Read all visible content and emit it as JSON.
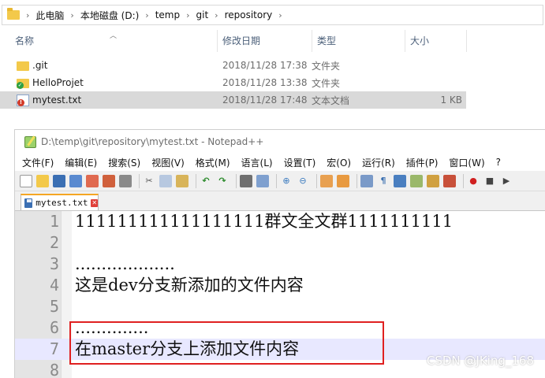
{
  "explorer": {
    "breadcrumb": [
      "此电脑",
      "本地磁盘 (D:)",
      "temp",
      "git",
      "repository"
    ],
    "columns": {
      "name": "名称",
      "date": "修改日期",
      "type": "类型",
      "size": "大小"
    },
    "files": [
      {
        "name": ".git",
        "date": "2018/11/28 17:38",
        "type": "文件夹",
        "size": "",
        "icon": "folder-icon"
      },
      {
        "name": "HelloProjet",
        "date": "2018/11/28 13:38",
        "type": "文件夹",
        "size": "",
        "icon": "folder-synced-icon"
      },
      {
        "name": "mytest.txt",
        "date": "2018/11/28 17:48",
        "type": "文本文档",
        "size": "1 KB",
        "icon": "text-file-modified-icon"
      }
    ]
  },
  "notepad": {
    "title": "D:\\temp\\git\\repository\\mytest.txt - Notepad++",
    "menu": [
      "文件(F)",
      "编辑(E)",
      "搜索(S)",
      "视图(V)",
      "格式(M)",
      "语言(L)",
      "设置(T)",
      "宏(O)",
      "运行(R)",
      "插件(P)",
      "窗口(W)",
      "?"
    ],
    "tab_label": "mytest.txt",
    "lines": [
      {
        "num": "1",
        "text": "111111111111111111群文全文群1111111111"
      },
      {
        "num": "2",
        "text": ""
      },
      {
        "num": "3",
        "text": "..................."
      },
      {
        "num": "4",
        "text": "这是dev分支新添加的文件内容"
      },
      {
        "num": "5",
        "text": ""
      },
      {
        "num": "6",
        "text": ".............."
      },
      {
        "num": "7",
        "text": "在master分支上添加文件内容"
      },
      {
        "num": "8",
        "text": ""
      }
    ]
  },
  "watermark": "CSDN @JKing_168",
  "colors": {
    "highlight": "#e02020",
    "current_line": "#e8e8ff",
    "selected_row": "#d9d9d9"
  }
}
